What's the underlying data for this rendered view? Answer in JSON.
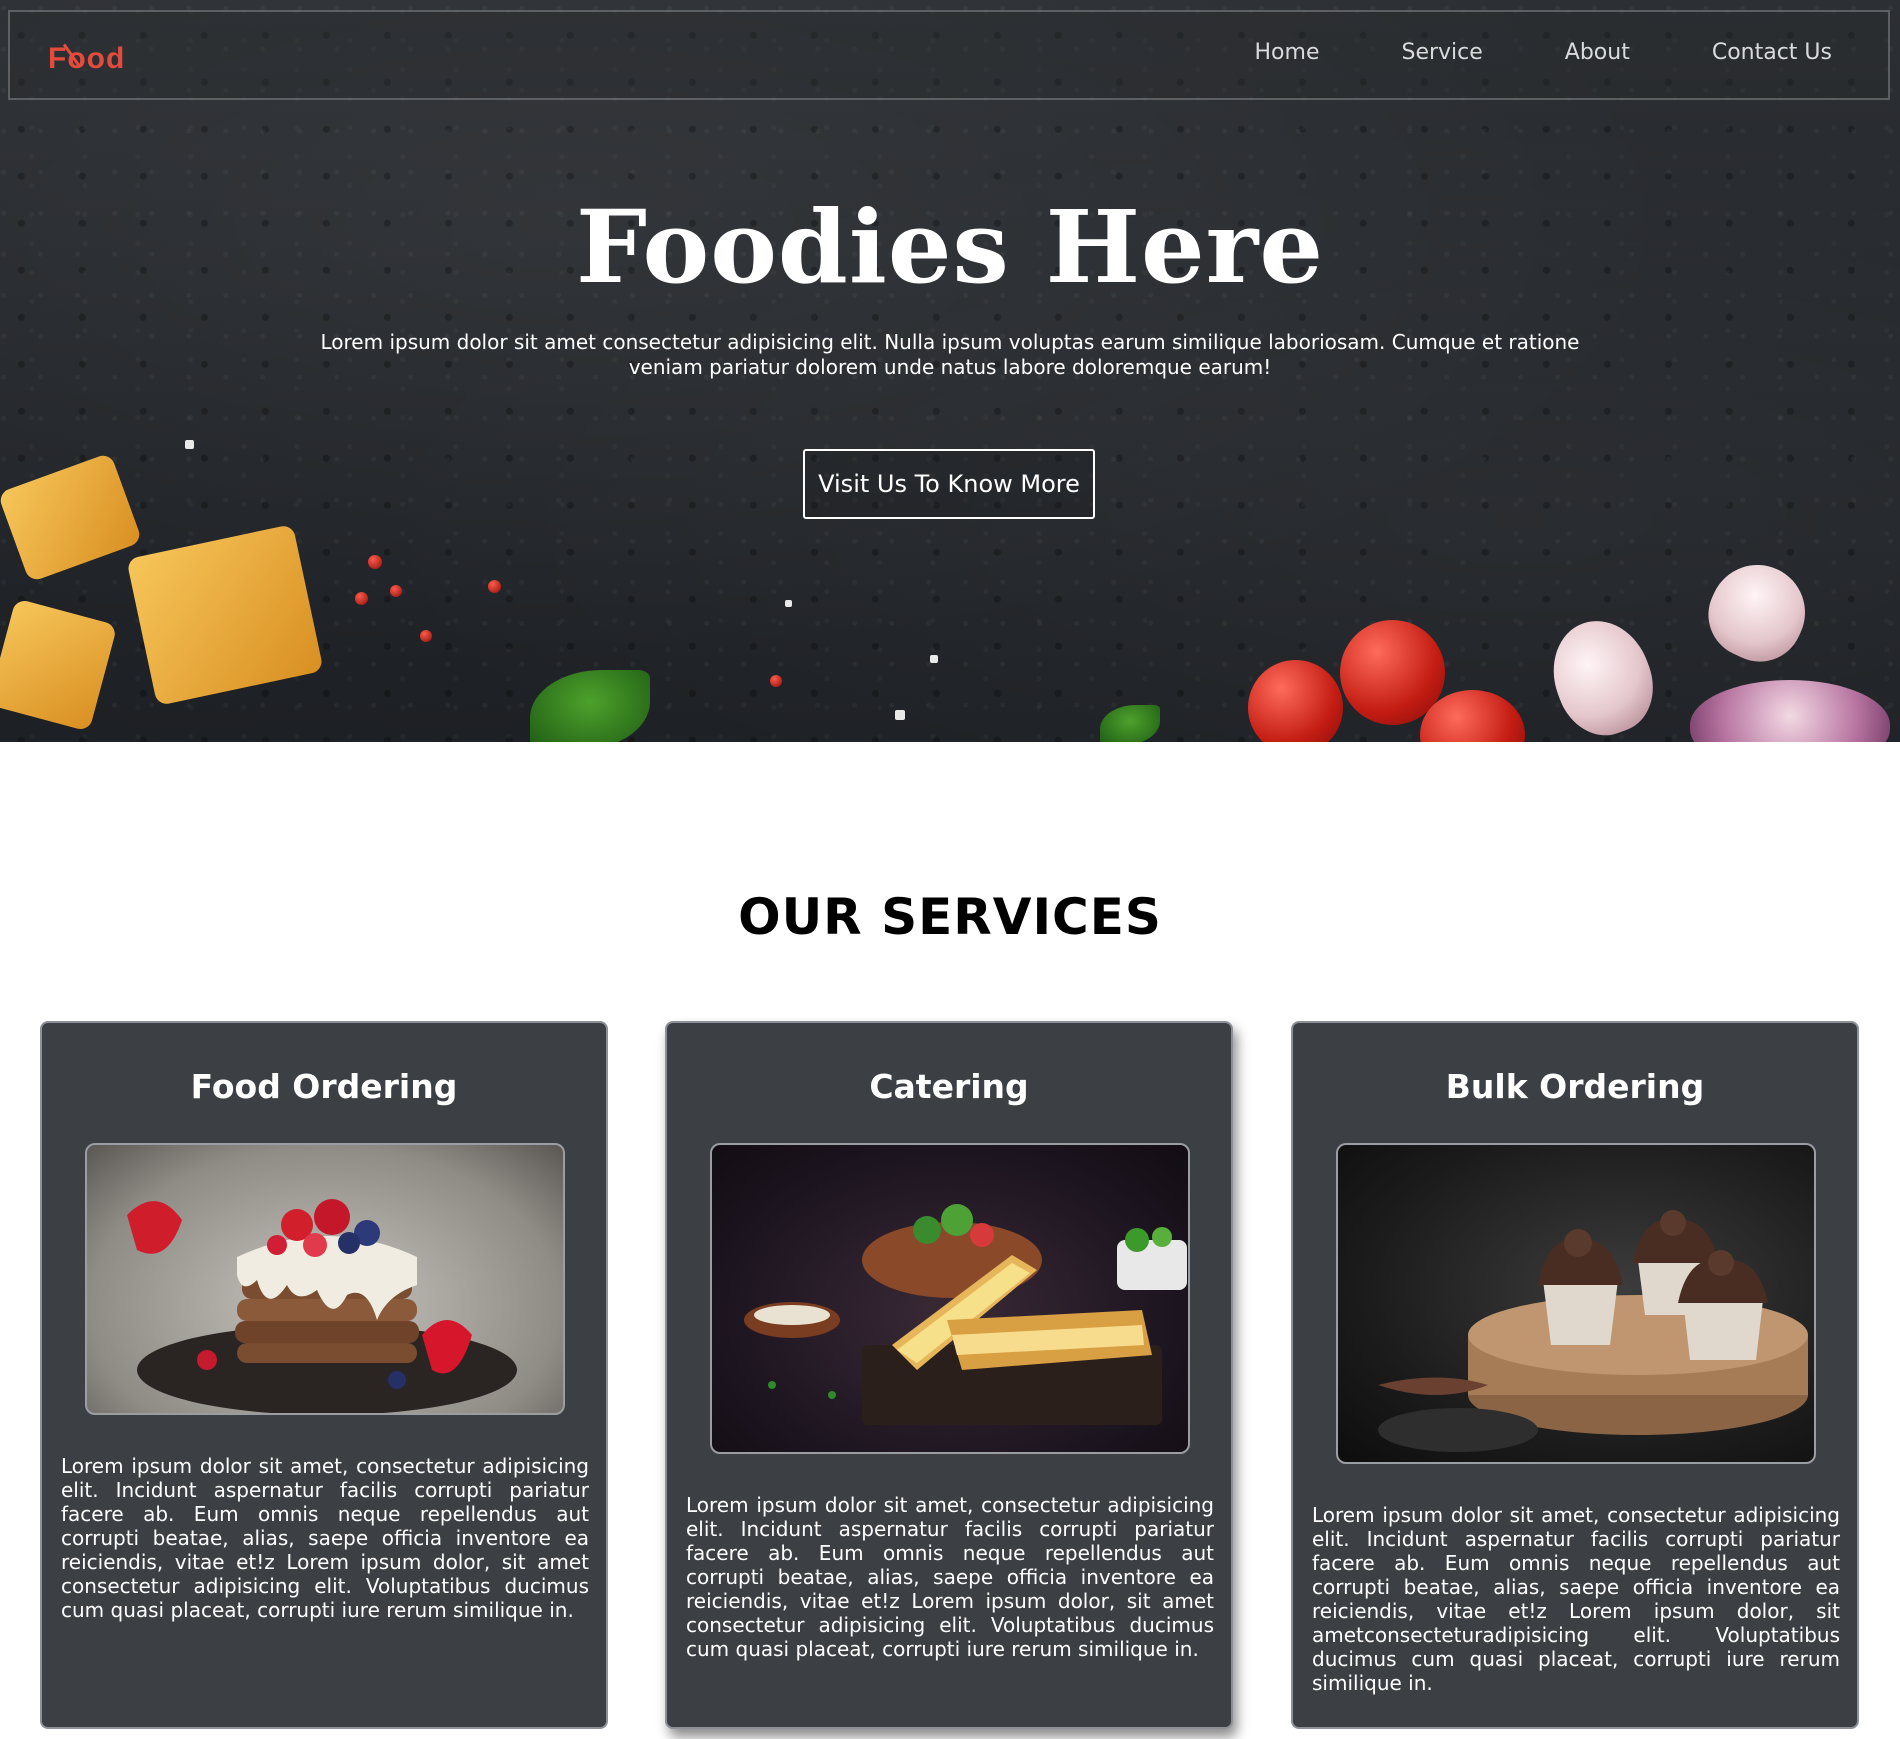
{
  "nav": {
    "logo": "Food",
    "links": [
      "Home",
      "Service",
      "About",
      "Contact Us"
    ]
  },
  "hero": {
    "title": "Foodies Here",
    "text": "Lorem ipsum dolor sit amet consectetur adipisicing elit. Nulla ipsum voluptas earum similique laboriosam. Cumque et ratione veniam pariatur dolorem unde natus labore doloremque earum!",
    "button": "Visit Us To Know More"
  },
  "services": {
    "title": "OUR SERVICES",
    "cards": [
      {
        "title": "Food Ordering",
        "image": "pancake-stack-photo",
        "text": "Lorem ipsum dolor sit amet, consectetur adipisicing elit. Incidunt aspernatur facilis corrupti pariatur facere ab. Eum omnis neque repellendus aut corrupti beatae, alias, saepe officia inventore ea reiciendis, vitae et!z Lorem ipsum dolor, sit amet consectetur adipisicing elit. Voluptatibus ducimus cum quasi placeat, corrupti iure rerum similique in."
      },
      {
        "title": "Catering",
        "image": "grilled-sandwich-photo",
        "text": "Lorem ipsum dolor sit amet, consectetur adipisicing elit. Incidunt aspernatur facilis corrupti pariatur facere ab. Eum omnis neque repellendus aut corrupti beatae, alias, saepe officia inventore ea reiciendis, vitae et!z Lorem ipsum dolor, sit amet consectetur adipisicing elit. Voluptatibus ducimus cum quasi placeat, corrupti iure rerum similique in."
      },
      {
        "title": "Bulk Ordering",
        "image": "chocolate-cupcakes-photo",
        "text": "Lorem ipsum dolor sit amet, consectetur adipisicing elit. Incidunt aspernatur facilis corrupti pariatur facere ab. Eum omnis neque repellendus aut corrupti beatae, alias, saepe officia inventore ea reiciendis, vitae et!z Lorem ipsum dolor, sit ametconsecteturadipisicing elit. Voluptatibus ducimus cum quasi placeat, corrupti iure rerum similique in."
      }
    ]
  },
  "colors": {
    "logo": "#e34b3d",
    "card_bg": "#3c4045",
    "hero_bg": "#24272b"
  }
}
